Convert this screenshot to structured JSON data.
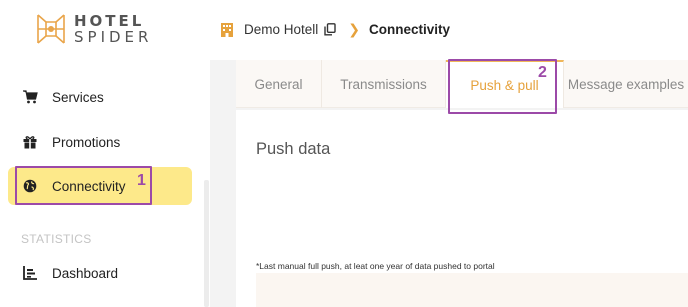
{
  "brand": {
    "line1": "HOTEL",
    "line2": "SPIDER"
  },
  "sidebar": {
    "items": [
      {
        "label": "Services",
        "icon": "cart-icon"
      },
      {
        "label": "Promotions",
        "icon": "gift-icon"
      },
      {
        "label": "Connectivity",
        "icon": "globe-icon",
        "active": true
      }
    ],
    "section_label": "STATISTICS",
    "stats_items": [
      {
        "label": "Dashboard",
        "icon": "chart-icon"
      }
    ]
  },
  "breadcrumb": {
    "hotel": "Demo Hotell",
    "current": "Connectivity"
  },
  "tabs": [
    {
      "label": "General"
    },
    {
      "label": "Transmissions"
    },
    {
      "label": "Push & pull",
      "active": true
    },
    {
      "label": "Message examples"
    }
  ],
  "panel": {
    "title": "Push data",
    "footnote": "*Last manual full push, at leat one year of data pushed to portal"
  },
  "annotations": [
    {
      "number": "1"
    },
    {
      "number": "2"
    }
  ],
  "colors": {
    "accent": "#e6a23c",
    "active_bg": "#fde98a",
    "annotation": "#9c4aa8"
  }
}
